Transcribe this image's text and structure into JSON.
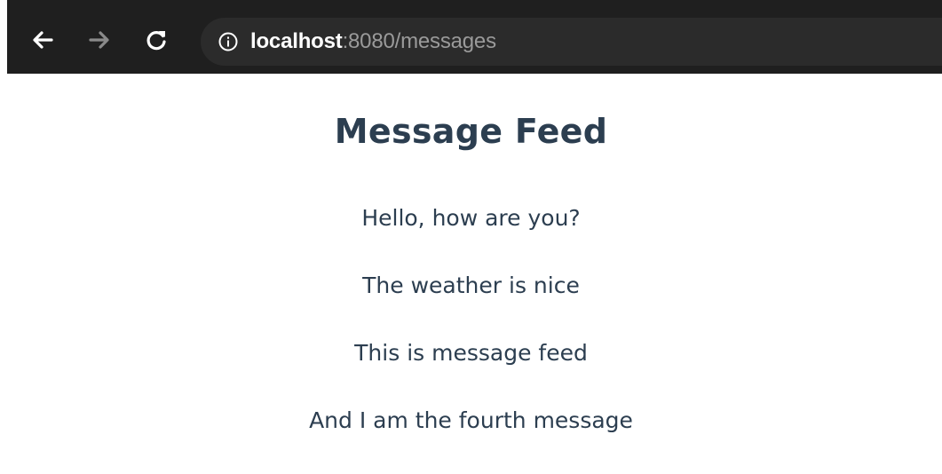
{
  "browser": {
    "url_host": "localhost",
    "url_rest": ":8080/messages",
    "icons": {
      "back": "arrow-left-icon",
      "forward": "arrow-right-icon",
      "reload": "reload-icon",
      "info": "info-icon"
    }
  },
  "page": {
    "title": "Message Feed",
    "messages": [
      "Hello, how are you?",
      "The weather is nice",
      "This is message feed",
      "And I am the fourth message"
    ]
  },
  "colors": {
    "browser_bar": "#1f1f1f",
    "omnibox": "#2b2b2b",
    "text": "#2c3e50"
  }
}
